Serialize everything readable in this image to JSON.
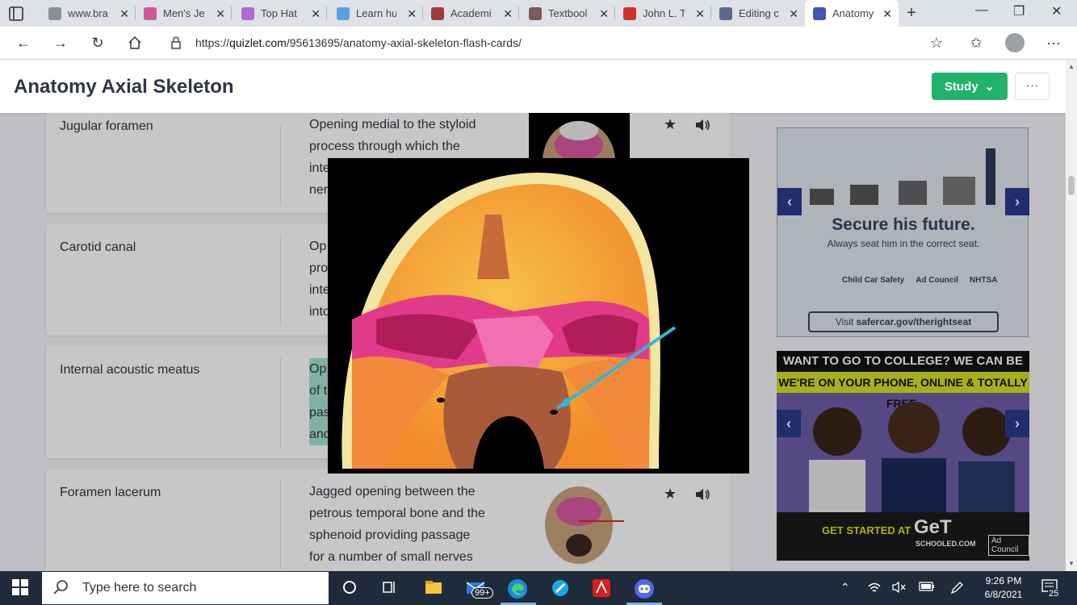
{
  "browser": {
    "tabs": [
      {
        "label": "www.bra",
        "color": "#8a8f98"
      },
      {
        "label": "Men's Je",
        "color": "#c85a9a"
      },
      {
        "label": "Top Hat",
        "color": "#b06ad0"
      },
      {
        "label": "Learn hu",
        "color": "#5aa0e0"
      },
      {
        "label": "Academi",
        "color": "#a03a3a"
      },
      {
        "label": "Textbool",
        "color": "#7a5a5a"
      },
      {
        "label": "John L. T",
        "color": "#d03030"
      },
      {
        "label": "Editing c",
        "color": "#5a6a8a"
      },
      {
        "label": "Anatomy",
        "color": "#4257b2"
      }
    ],
    "url_prefix": "https://",
    "url_host": "quizlet.com",
    "url_path": "/95613695/anatomy-axial-skeleton-flash-cards/"
  },
  "page": {
    "title": "Anatomy Axial Skeleton",
    "study_label": "Study",
    "more_label": "···"
  },
  "cards": [
    {
      "term": "Jugular foramen",
      "def_lines": [
        "Opening medial to the styloid",
        "process through which the",
        "inte",
        "ner"
      ]
    },
    {
      "term": "Carotid canal",
      "def_lines": [
        "Op",
        "pro",
        "inte",
        "into"
      ]
    },
    {
      "term": "Internal acoustic meatus",
      "def_lines": [
        "Op",
        "of t",
        "pas",
        "and"
      ]
    },
    {
      "term": "Foramen lacerum",
      "def_lines": [
        "Jagged opening between the",
        "petrous temporal bone and the",
        "sphenoid providing passage",
        "for a number of small nerves"
      ]
    }
  ],
  "ads": {
    "ad1": {
      "headline": "Secure his future.",
      "sub": "Always seat him in the correct seat.",
      "logo1": "Child Car Safety",
      "logo2": "Ad Council",
      "logo3": "NHTSA",
      "visit_prefix": "Visit ",
      "visit_url": "safercar.gov/therightseat"
    },
    "ad2": {
      "line1": "WANT TO GO TO COLLEGE? WE CAN BE YOUR GUIDE.",
      "line2": "WE'RE ON YOUR PHONE, ONLINE & TOTALLY FREE.",
      "cta": "GET STARTED AT",
      "brand": "GeT",
      "brand_sub": "SCHOOLED.COM",
      "adcouncil": "Ad Council"
    }
  },
  "taskbar": {
    "search_placeholder": "Type here to search",
    "mail_badge": "99+",
    "time": "9:26 PM",
    "date": "6/8/2021",
    "notifications": "25"
  },
  "colors": {
    "study": "#23b26d",
    "highlight": "#a8e2d4",
    "taskbar": "#1f2b3a"
  }
}
